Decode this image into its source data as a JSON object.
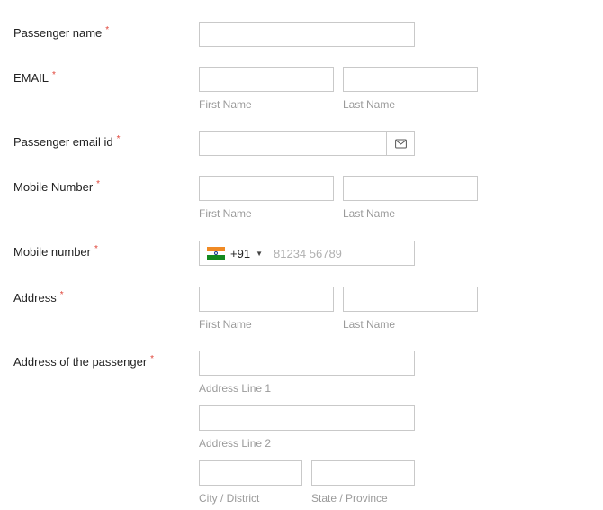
{
  "required_mark": "*",
  "fields": {
    "passenger_name": {
      "label": "Passenger name"
    },
    "email": {
      "label": "EMAIL",
      "first_hint": "First Name",
      "last_hint": "Last Name"
    },
    "passenger_email": {
      "label": "Passenger email id",
      "icon": "envelope-icon"
    },
    "mobile_number_name": {
      "label": "Mobile Number",
      "first_hint": "First Name",
      "last_hint": "Last Name"
    },
    "mobile_number": {
      "label": "Mobile number",
      "country_flag": "india-flag-icon",
      "dial_code": "+91",
      "placeholder": "81234 56789"
    },
    "address_name": {
      "label": "Address",
      "first_hint": "First Name",
      "last_hint": "Last Name"
    },
    "passenger_address": {
      "label": "Address of the passenger",
      "line1_hint": "Address Line 1",
      "line2_hint": "Address Line 2",
      "city_hint": "City / District",
      "state_hint": "State / Province"
    }
  },
  "colors": {
    "required": "#e0463b",
    "border": "#c9c9c9",
    "hint_text": "#9a9a9a",
    "flag_saffron": "#f08a24",
    "flag_green": "#138a1f"
  }
}
